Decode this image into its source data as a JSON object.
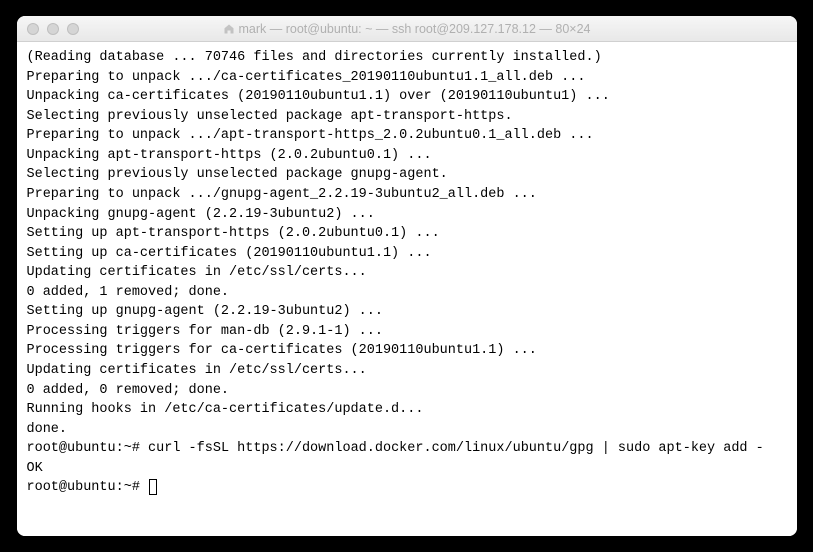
{
  "window": {
    "title": "mark — root@ubuntu: ~ — ssh root@209.127.178.12 — 80×24"
  },
  "output": [
    "(Reading database ... 70746 files and directories currently installed.)",
    "Preparing to unpack .../ca-certificates_20190110ubuntu1.1_all.deb ...",
    "Unpacking ca-certificates (20190110ubuntu1.1) over (20190110ubuntu1) ...",
    "Selecting previously unselected package apt-transport-https.",
    "Preparing to unpack .../apt-transport-https_2.0.2ubuntu0.1_all.deb ...",
    "Unpacking apt-transport-https (2.0.2ubuntu0.1) ...",
    "Selecting previously unselected package gnupg-agent.",
    "Preparing to unpack .../gnupg-agent_2.2.19-3ubuntu2_all.deb ...",
    "Unpacking gnupg-agent (2.2.19-3ubuntu2) ...",
    "Setting up apt-transport-https (2.0.2ubuntu0.1) ...",
    "Setting up ca-certificates (20190110ubuntu1.1) ...",
    "Updating certificates in /etc/ssl/certs...",
    "0 added, 1 removed; done.",
    "Setting up gnupg-agent (2.2.19-3ubuntu2) ...",
    "Processing triggers for man-db (2.9.1-1) ...",
    "Processing triggers for ca-certificates (20190110ubuntu1.1) ...",
    "Updating certificates in /etc/ssl/certs...",
    "0 added, 0 removed; done.",
    "Running hooks in /etc/ca-certificates/update.d...",
    "done."
  ],
  "prompts": [
    {
      "prompt": "root@ubuntu:~# ",
      "command": "curl -fsSL https://download.docker.com/linux/ubuntu/gpg | sudo apt-key add -",
      "result": "OK"
    },
    {
      "prompt": "root@ubuntu:~# ",
      "command": ""
    }
  ]
}
